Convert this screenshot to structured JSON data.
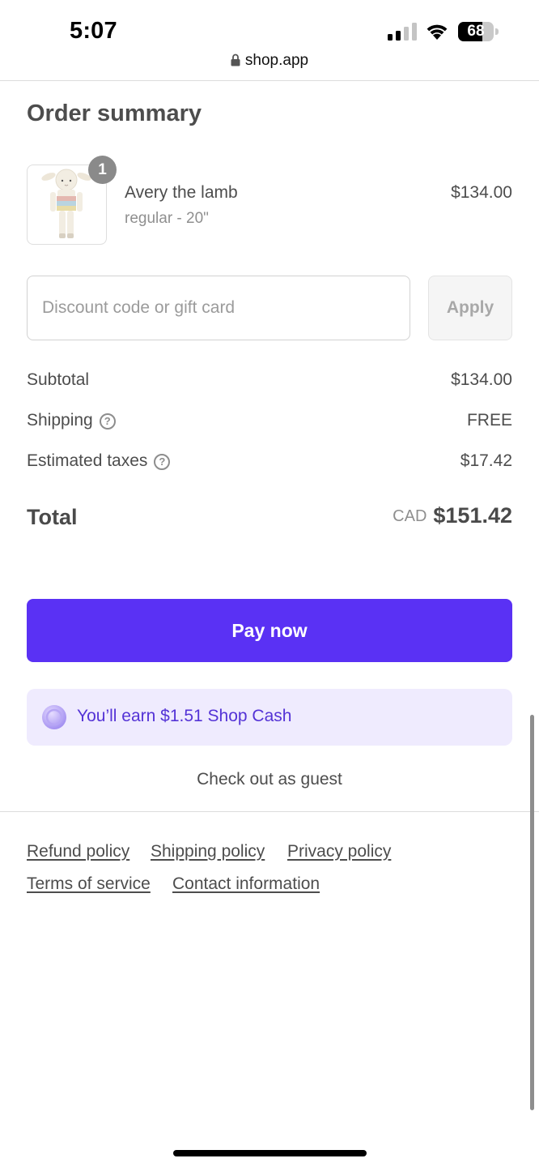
{
  "status_bar": {
    "time": "5:07",
    "battery_level": "68",
    "battery_fraction": 0.68
  },
  "browser": {
    "url": "shop.app"
  },
  "order_summary": {
    "title": "Order summary",
    "item": {
      "name": "Avery the lamb",
      "variant": "regular - 20\"",
      "price": "$134.00",
      "quantity": "1"
    },
    "discount": {
      "placeholder": "Discount code or gift card",
      "value": "",
      "apply_label": "Apply"
    },
    "subtotal": {
      "label": "Subtotal",
      "value": "$134.00"
    },
    "shipping": {
      "label": "Shipping",
      "value": "FREE",
      "help_glyph": "?"
    },
    "taxes": {
      "label": "Estimated taxes",
      "value": "$17.42",
      "help_glyph": "?"
    },
    "total": {
      "label": "Total",
      "currency": "CAD",
      "value": "$151.42"
    }
  },
  "actions": {
    "pay_label": "Pay now",
    "shop_cash_text": "You’ll earn $1.51 Shop Cash",
    "guest_label": "Check out as guest"
  },
  "footer": {
    "links": [
      "Refund policy",
      "Shipping policy",
      "Privacy policy",
      "Terms of service",
      "Contact information"
    ]
  },
  "colors": {
    "accent": "#5a31f4",
    "shop_cash_bg": "#efebfe",
    "shop_cash_text": "#5433d6"
  }
}
